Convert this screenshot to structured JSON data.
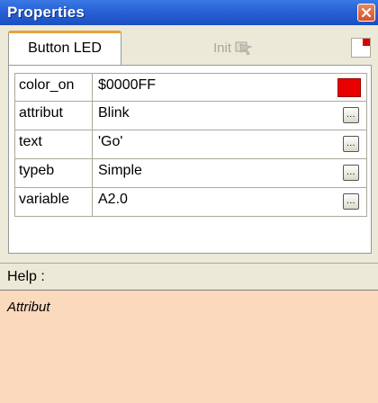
{
  "window": {
    "title": "Properties"
  },
  "tabs": [
    {
      "label": "Button LED",
      "active": true
    }
  ],
  "toolbar": {
    "init_label": "Init"
  },
  "properties": [
    {
      "name": "color_on",
      "value": "$0000FF",
      "editor": "color",
      "color": "#e80000"
    },
    {
      "name": "attribut",
      "value": "Blink",
      "editor": "ellipsis"
    },
    {
      "name": "text",
      "value": "'Go'",
      "editor": "ellipsis"
    },
    {
      "name": "typeb",
      "value": "Simple",
      "editor": "ellipsis"
    },
    {
      "name": "variable",
      "value": "A2.0",
      "editor": "ellipsis"
    }
  ],
  "ellipsis_label": "...",
  "help": {
    "label": "Help :",
    "text": "Attribut"
  },
  "colors": {
    "title_bar": "#2a63d6",
    "help_background": "#fbd9bc",
    "tab_accent": "#e8a33d"
  }
}
